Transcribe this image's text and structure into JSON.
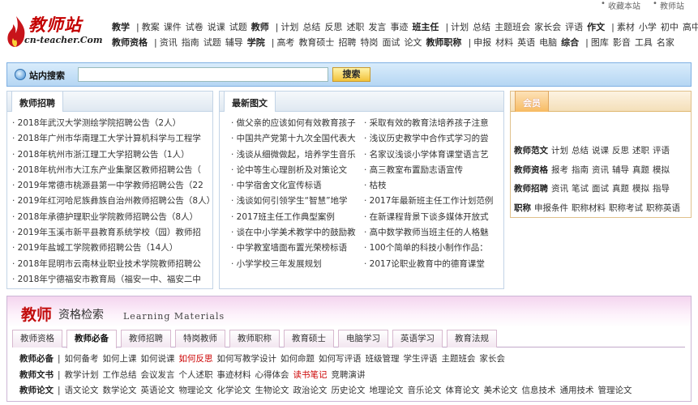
{
  "topbar": {
    "bookmark": "收藏本站",
    "home": "教师站"
  },
  "logo": {
    "cn": "教师站",
    "domain": "cn-teacher.Com"
  },
  "nav": {
    "row1": [
      {
        "t": "教学",
        "b": true
      },
      {
        "t": "|"
      },
      {
        "t": "教案"
      },
      {
        "t": "课件"
      },
      {
        "t": "试卷"
      },
      {
        "t": "说课"
      },
      {
        "t": "试题"
      },
      {
        "t": "教师",
        "b": true
      },
      {
        "t": "|"
      },
      {
        "t": "计划"
      },
      {
        "t": "总结"
      },
      {
        "t": "反思"
      },
      {
        "t": "述职"
      },
      {
        "t": "发言"
      },
      {
        "t": "事迹"
      },
      {
        "t": "班主任",
        "b": true
      },
      {
        "t": "|"
      },
      {
        "t": "计划"
      },
      {
        "t": "总结"
      },
      {
        "t": "主题班会"
      },
      {
        "t": "家长会"
      },
      {
        "t": "评语"
      },
      {
        "t": "作文",
        "b": true
      },
      {
        "t": "|"
      },
      {
        "t": "素材"
      },
      {
        "t": "小学"
      },
      {
        "t": "初中"
      },
      {
        "t": "高中"
      }
    ],
    "row2": [
      {
        "t": "教师资格",
        "b": true
      },
      {
        "t": "|"
      },
      {
        "t": "资讯"
      },
      {
        "t": "指南"
      },
      {
        "t": "试题"
      },
      {
        "t": "辅导"
      },
      {
        "t": "学院",
        "b": true
      },
      {
        "t": "|"
      },
      {
        "t": "高考"
      },
      {
        "t": "教育硕士"
      },
      {
        "t": "招聘"
      },
      {
        "t": "特岗"
      },
      {
        "t": "面试"
      },
      {
        "t": "论文"
      },
      {
        "t": "教师职称",
        "b": true
      },
      {
        "t": "|"
      },
      {
        "t": "申报"
      },
      {
        "t": "材料"
      },
      {
        "t": "英语"
      },
      {
        "t": "电脑"
      },
      {
        "t": "综合",
        "b": true
      },
      {
        "t": "|"
      },
      {
        "t": "图库"
      },
      {
        "t": "影音"
      },
      {
        "t": "工具"
      },
      {
        "t": "名家"
      }
    ]
  },
  "search": {
    "label": "站内搜索",
    "button": "搜索",
    "value": ""
  },
  "panel_recruit": {
    "title": "教师招聘",
    "items": [
      "· 2018年武汉大学测绘学院招聘公告（2人）",
      "· 2018年广州市华南理工大学计算机科学与工程学",
      "· 2018年杭州市浙江理工大学招聘公告（1人）",
      "· 2018年杭州市大江东产业集聚区教师招聘公告（",
      "· 2019年常德市桃源县第一中学教师招聘公告（22",
      "· 2019年红河哈尼族彝族自治州教师招聘公告（8人）",
      "· 2018年承德护理职业学院教师招聘公告（8人）",
      "· 2019年玉溪市新平县教育系统学校（园）教师招",
      "· 2019年盐城工学院教师招聘公告（14人）",
      "· 2018年昆明市云南林业职业技术学院教师招聘公",
      "· 2018年宁德福安市教育局（福安一中、福安二中"
    ]
  },
  "panel_latest": {
    "title": "最新图文",
    "left": [
      "· 做父亲的应该如何有效教育孩子",
      "· 中国共产党第十九次全国代表大",
      "· 浅谈从细微做起，培养学生音乐",
      "· 论中等生心理剖析及对策论文",
      "· 中学宿舍文化宣传标语",
      "· 浅谈如何引领学生“智慧”地学",
      "· 2017班主任工作典型案例",
      "· 谈在中小学美术教学中的鼓励教",
      "· 中学教室墙面布置光荣榜标语",
      "· 小学学校三年发展规划"
    ],
    "right": [
      "· 采取有效的教育法培养孩子注意",
      "· 浅议历史教学中合作式学习的尝",
      "· 名家议浅谈小学体育课堂语言艺",
      "· 高三教室布置励志语宣传",
      "· 枯枝",
      "· 2017年最新班主任工作计划范例",
      "· 在新课程背景下谈多媒体开放式",
      "· 高中数学教师当班主任的人格魅",
      "· 100个简单的科技小制作作品：",
      "· 2017论职业教育中的德育课堂"
    ]
  },
  "panel_member": {
    "title": "会员",
    "rows": [
      {
        "h": "教师范文",
        "items": [
          "计划",
          "总结",
          "说课",
          "反思",
          "述职",
          "评语"
        ]
      },
      {
        "h": "教师资格",
        "items": [
          "报考",
          "指南",
          "资讯",
          "辅导",
          "真题",
          "模拟"
        ]
      },
      {
        "h": "教师招聘",
        "items": [
          "资讯",
          "笔试",
          "面试",
          "真题",
          "模拟",
          "指导"
        ]
      },
      {
        "h": "职称",
        "items": [
          "申报条件",
          "职称材料",
          "职称考试",
          "职称英语"
        ]
      }
    ]
  },
  "learning": {
    "title_cn1": "教师",
    "title_cn2": "资格检索",
    "title_en": "Learning Materials",
    "tabs": [
      "教师资格",
      "教师必备",
      "教师招聘",
      "特岗教师",
      "教师职称",
      "教育硕士",
      "电脑学习",
      "英语学习",
      "教育法规"
    ],
    "active_tab": 1,
    "rows": [
      {
        "h": "教师必备",
        "items": [
          "如何备考",
          "如何上课",
          "如何说课",
          "如何反思",
          "如何写教学设计",
          "如何命题",
          "如何写评语",
          "班级管理",
          "学生评语",
          "主题班会",
          "家长会"
        ],
        "highlight": [
          3
        ]
      },
      {
        "h": "教师文书",
        "items": [
          "教学计划",
          "工作总结",
          "会议发言",
          "个人述职",
          "事迹材料",
          "心得体会",
          "读书笔记",
          "竞聘演讲"
        ],
        "highlight": [
          6
        ]
      },
      {
        "h": "教师论文",
        "items": [
          "语文论文",
          "数学论文",
          "英语论文",
          "物理论文",
          "化学论文",
          "生物论文",
          "政治论文",
          "历史论文",
          "地理论文",
          "音乐论文",
          "体育论文",
          "美术论文",
          "信息技术",
          "通用技术",
          "管理论文"
        ],
        "highlight": []
      }
    ]
  }
}
